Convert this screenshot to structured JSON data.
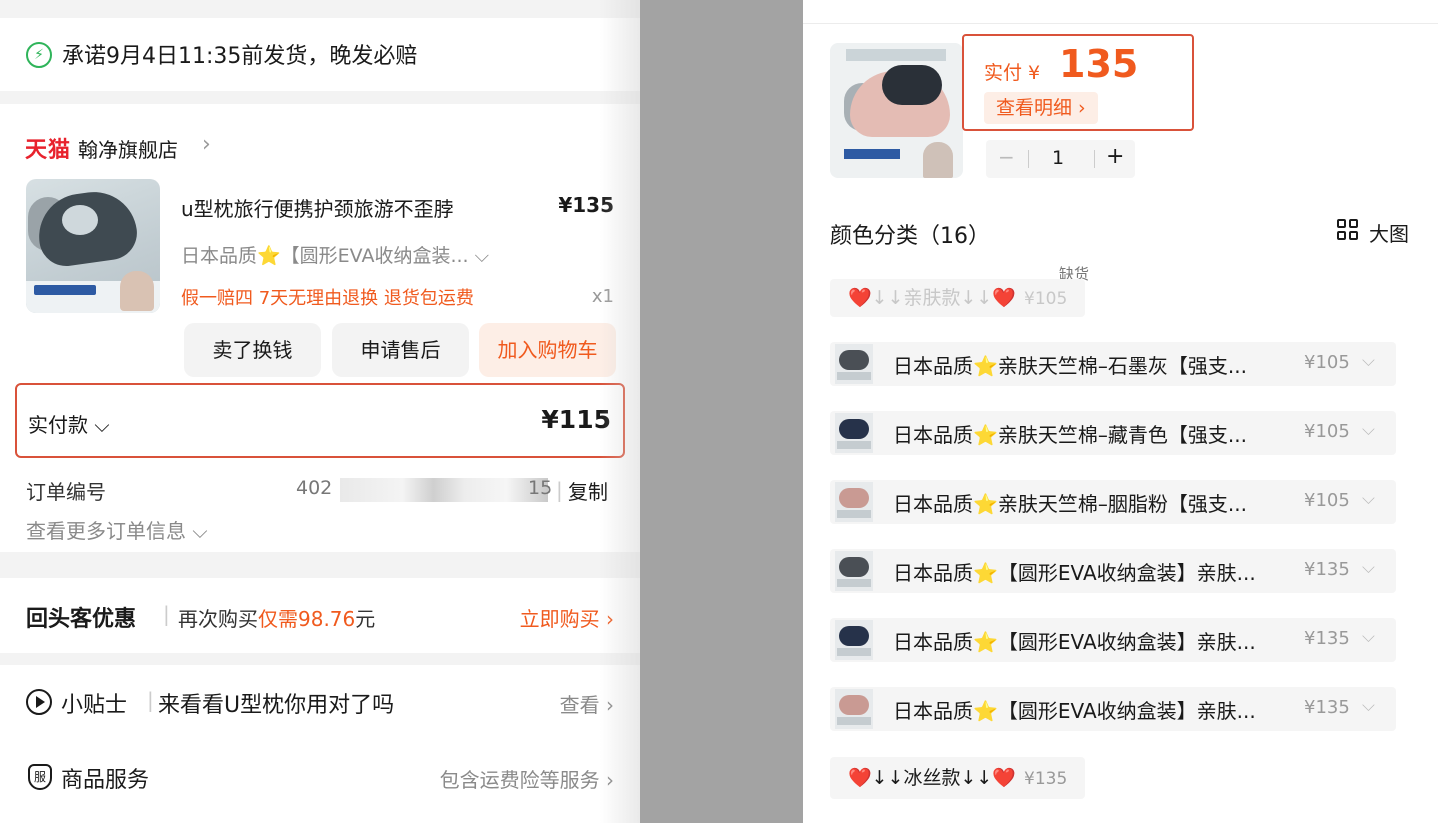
{
  "left": {
    "shipping": {
      "text": "承诺9月4日11:35前发货，晚发必赔",
      "icon": "lightning-icon"
    },
    "shop": {
      "platform": "天猫",
      "name": "翰净旗舰店",
      "arrow": "›"
    },
    "product": {
      "title": "u型枕旅行便携护颈旅游不歪脖",
      "price": "¥135",
      "spec": "日本品质⭐【圆形EVA收纳盒装... ⌵",
      "tags": "假一赔四  7天无理由退换  退货包运费",
      "qty": "x1"
    },
    "actions": {
      "sell": "卖了换钱",
      "after_sale": "申请售后",
      "add_cart": "加入购物车"
    },
    "payment": {
      "label": "实付款 ⌵",
      "value": "¥115"
    },
    "order_no": {
      "label": "订单编号",
      "prefix": "402",
      "suffix": "15",
      "copy": "复制"
    },
    "more_info": "查看更多订单信息 ⌵",
    "rebuy": {
      "title": "回头客优惠",
      "desc_prefix": "再次购买",
      "desc_highlight": "仅需98.76",
      "desc_suffix": "元",
      "cta": "立即购买 ›"
    },
    "tips": {
      "title": "小贴士",
      "desc": "来看看U型枕你用对了吗",
      "cta": "查看 ›"
    },
    "service": {
      "title": "商品服务",
      "cta": "包含运费险等服务 ›",
      "badge": "服"
    }
  },
  "right": {
    "price": {
      "label": "实付 ¥",
      "value": "135",
      "detail": "查看明细 ›"
    },
    "stepper": {
      "minus": "−",
      "value": "1",
      "plus": "+"
    },
    "section": {
      "title": "颜色分类（16）",
      "big_view": "大图"
    },
    "variants_top": [
      {
        "name": "❤️↓↓亲肤款↓↓❤️",
        "price": "¥105",
        "tag": "缺货",
        "disabled": true
      }
    ],
    "variants": [
      {
        "name": "日本品质⭐亲肤天竺棉–石墨灰【强支...",
        "price": "¥105",
        "swatch": "#4a4f55"
      },
      {
        "name": "日本品质⭐亲肤天竺棉–藏青色【强支...",
        "price": "¥105",
        "swatch": "#26324a"
      },
      {
        "name": "日本品质⭐亲肤天竺棉–胭脂粉【强支...",
        "price": "¥105",
        "swatch": "#c99a93"
      },
      {
        "name": "日本品质⭐【圆形EVA收纳盒装】亲肤...",
        "price": "¥135",
        "swatch": "#4a4f55"
      },
      {
        "name": "日本品质⭐【圆形EVA收纳盒装】亲肤...",
        "price": "¥135",
        "swatch": "#26324a"
      },
      {
        "name": "日本品质⭐【圆形EVA收纳盒装】亲肤...",
        "price": "¥135",
        "swatch": "#c99a93"
      }
    ],
    "variants_bottom": [
      {
        "name": "❤️↓↓冰丝款↓↓❤️",
        "price": "¥135"
      }
    ]
  }
}
